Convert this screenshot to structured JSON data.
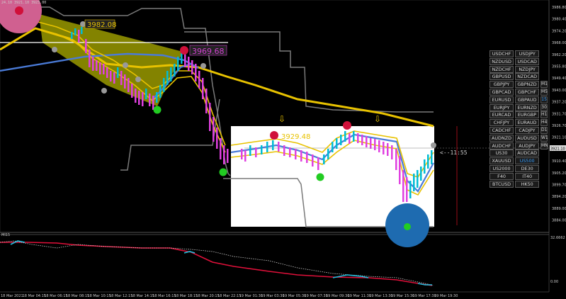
{
  "header": {
    "info": "24.10 3921.10 3923.00"
  },
  "indicator": {
    "label": "MI15",
    "scale_top": "32.6662",
    "scale_bottom": "0.00"
  },
  "price_axis": {
    "labels": [
      "3986.80",
      "3980.40",
      "3974.20",
      "3968.00",
      "3962.20",
      "3955.80",
      "3949.40",
      "3943.00",
      "3937.20",
      "3931.70",
      "3926.70",
      "3921.10",
      "3915.60",
      "3910.40",
      "3905.20",
      "3899.70",
      "3894.20",
      "3889.00",
      "3884.00"
    ],
    "current_price": "3921.10"
  },
  "time_axis": {
    "labels": [
      "18 Mar 2021",
      "18 Mar 04:15",
      "18 Mar 06:15",
      "18 Mar 08:15",
      "18 Mar 10:15",
      "18 Mar 12:15",
      "18 Mar 14:15",
      "18 Mar 16:15",
      "18 Mar 18:15",
      "18 Mar 20:15",
      "18 Mar 22:15",
      "19 Mar 01:30",
      "19 Mar 03:30",
      "19 Mar 05:30",
      "19 Mar 07:30",
      "19 Mar 09:30",
      "19 Mar 11:30",
      "19 Mar 13:30",
      "19 Mar 15:30",
      "19 Mar 17:30",
      "19 Mar 19:30"
    ]
  },
  "annotations": {
    "level1": "3982.08",
    "level2": "3969.68",
    "level3": "3929.48",
    "countdown": "<--11:55",
    "arrow_glyph": "⇩"
  },
  "colors": {
    "yellow_band": "#e8c200",
    "blue_ma": "#4a7bd8",
    "candle_up": "#00bcd4",
    "candle_down": "#e040e0",
    "envelope": "#7a7a7a",
    "red_dot": "#d0103a",
    "green_dot": "#22cc22",
    "pink_circle": "#d06090",
    "blue_circle": "#1e6bb0",
    "indicator_red": "#e0103a",
    "indicator_cyan": "#20c0e0"
  },
  "symbol_panel": {
    "rows": [
      {
        "left": "USDCHF",
        "right": "USDJPY",
        "tf": ""
      },
      {
        "left": "NZDUSD",
        "right": "USDCAD",
        "tf": ""
      },
      {
        "left": "NZDCHF",
        "right": "NZDJPY",
        "tf": ""
      },
      {
        "left": "GBPUSD",
        "right": "NZDCAD",
        "tf": ""
      },
      {
        "left": "GBPJPY",
        "right": "GBPNZD",
        "tf": "M1"
      },
      {
        "left": "GBPCAD",
        "right": "GBPCHF",
        "tf": "M5"
      },
      {
        "left": "EURUSD",
        "right": "GBPAUD",
        "tf": "15"
      },
      {
        "left": "EURJPY",
        "right": "EURNZD",
        "tf": "30"
      },
      {
        "left": "EURCAD",
        "right": "EURGBP",
        "tf": "H1"
      },
      {
        "left": "CHFJPY",
        "right": "EURAUD",
        "tf": "H4"
      },
      {
        "left": "CADCHF",
        "right": "CADJPY",
        "tf": "D1"
      },
      {
        "left": "AUDNZD",
        "right": "AUDUSD",
        "tf": "W1"
      },
      {
        "left": "AUDCHF",
        "right": "AUDJPY",
        "tf": "MN"
      },
      {
        "left": "US30",
        "right": "AUDCAD",
        "tf": ""
      },
      {
        "left": "XAUUSD",
        "right": "US500",
        "tf": ""
      },
      {
        "left": "US2000",
        "right": "DE30",
        "tf": ""
      },
      {
        "left": "F40",
        "right": "IT40",
        "tf": ""
      },
      {
        "left": "BTCUSD",
        "right": "HK50",
        "tf": ""
      }
    ],
    "active_symbol": "US500",
    "active_tf": "15"
  }
}
